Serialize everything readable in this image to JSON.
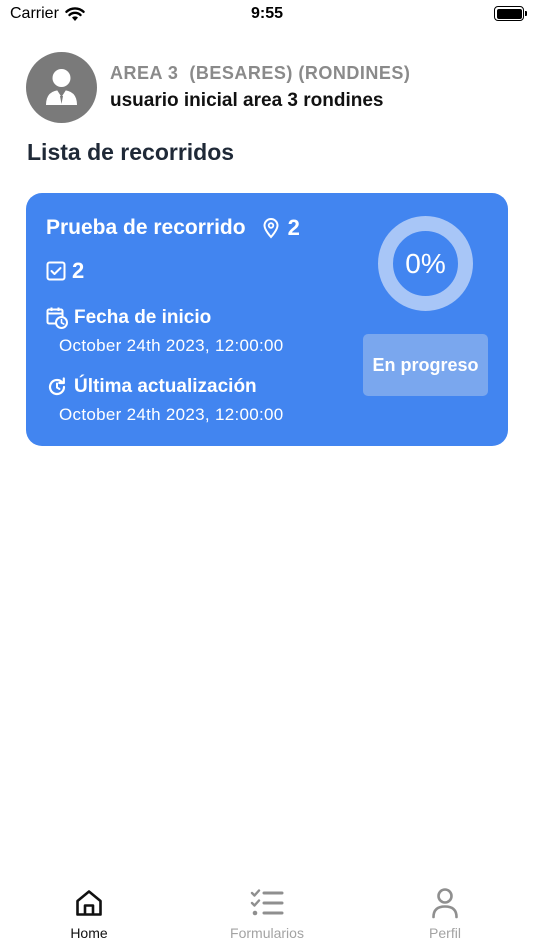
{
  "status_bar": {
    "carrier": "Carrier",
    "time": "9:55"
  },
  "header": {
    "area_name": "AREA 3  (BESARES) (RONDINES)",
    "user_name": "usuario inicial area 3 rondines"
  },
  "section_title": "Lista de recorridos",
  "tour_card": {
    "title": "Prueba de recorrido",
    "points_count": "2",
    "forms_count": "2",
    "start_label": "Fecha de inicio",
    "start_value": "October 24th 2023, 12:00:00",
    "update_label": "Última actualización",
    "update_value": "October 24th 2023, 12:00:00",
    "progress_text": "0%",
    "progress_fraction": 0,
    "status": "En progreso",
    "colors": {
      "card": "#4285f0",
      "ring": "#a8c6f7",
      "badge": "#7aa7ee"
    }
  },
  "tab_bar": {
    "tabs": [
      {
        "label": "Home",
        "icon": "home-icon",
        "active": true
      },
      {
        "label": "Formularios",
        "icon": "checklist-icon",
        "active": false
      },
      {
        "label": "Perfil",
        "icon": "person-icon",
        "active": false
      }
    ]
  }
}
